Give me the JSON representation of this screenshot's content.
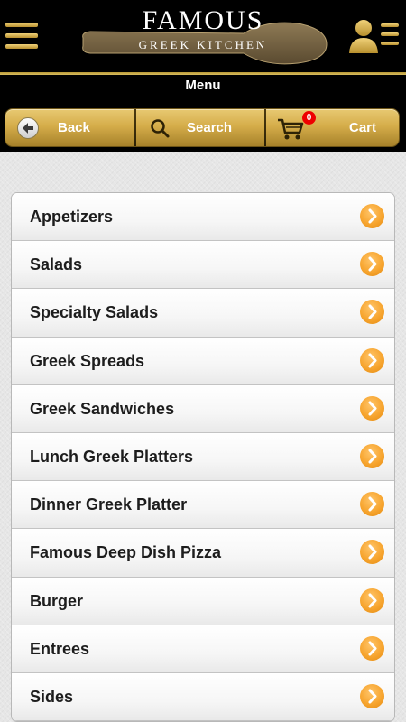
{
  "header": {
    "logo_title": "FAMOUS",
    "logo_subtitle": "GREEK KITCHEN",
    "page_title": "Menu"
  },
  "nav": {
    "back_label": "Back",
    "search_label": "Search",
    "cart_label": "Cart",
    "cart_count": "0"
  },
  "menu_items": [
    {
      "label": "Appetizers"
    },
    {
      "label": "Salads"
    },
    {
      "label": "Specialty Salads"
    },
    {
      "label": "Greek Spreads"
    },
    {
      "label": "Greek Sandwiches"
    },
    {
      "label": "Lunch Greek Platters"
    },
    {
      "label": "Dinner Greek Platter"
    },
    {
      "label": "Famous Deep Dish Pizza"
    },
    {
      "label": "Burger"
    },
    {
      "label": "Entrees"
    },
    {
      "label": "Sides"
    }
  ],
  "colors": {
    "gold": "#d5ad4a",
    "arrow_orange": "#f7a52f",
    "badge_red": "#e00000"
  }
}
